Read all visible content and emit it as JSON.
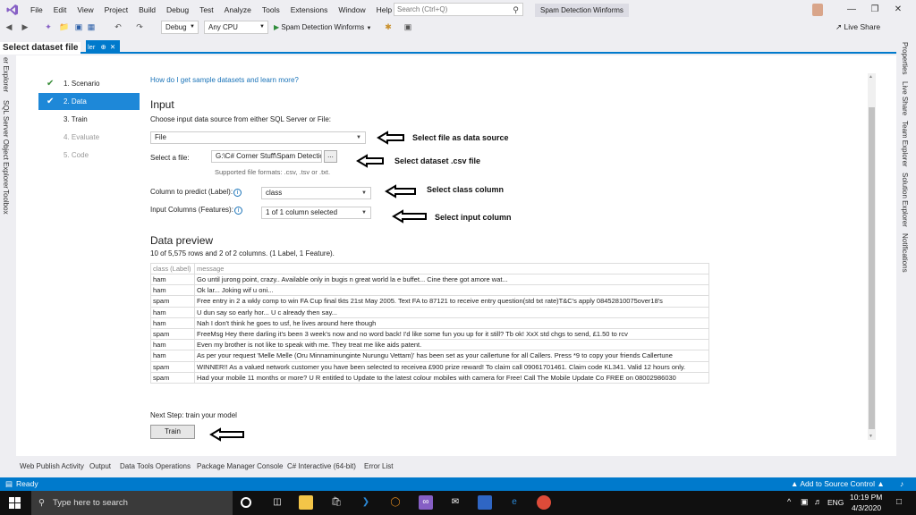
{
  "overlay_label": "Select dataset file",
  "menu": [
    "File",
    "Edit",
    "View",
    "Project",
    "Build",
    "Debug",
    "Test",
    "Analyze",
    "Tools",
    "Extensions",
    "Window",
    "Help"
  ],
  "search": {
    "placeholder": "Search (Ctrl+Q)"
  },
  "solution_title": "Spam Detection Winforms",
  "toolbar": {
    "config": "Debug",
    "platform": "Any CPU",
    "start_label": "Spam Detection Winforms",
    "live_share": "Live Share"
  },
  "doc_tab": {
    "label": "ler"
  },
  "left_panels": [
    "er Explorer",
    "SQL Server Object Explorer",
    "Toolbox"
  ],
  "right_panels": [
    "Properties",
    "Live Share",
    "Team Explorer",
    "Solution Explorer",
    "Notifications"
  ],
  "steps": [
    {
      "label": "1. Scenario",
      "state": "done"
    },
    {
      "label": "2. Data",
      "state": "active"
    },
    {
      "label": "3. Train",
      "state": "normal"
    },
    {
      "label": "4. Evaluate",
      "state": "disabled"
    },
    {
      "label": "5. Code",
      "state": "disabled"
    }
  ],
  "help_link": "How do I get sample datasets and learn more?",
  "input": {
    "heading": "Input",
    "description": "Choose input data source from either SQL Server or File:",
    "source_value": "File",
    "file_label": "Select a file:",
    "file_value": "G:\\C# Corner Stuff\\Spam Detectio",
    "browse_label": "...",
    "formats": "Supported file formats: .csv, .tsv or .txt.",
    "label_col_label": "Column to predict (Label):",
    "label_col_value": "class",
    "features_label": "Input Columns (Features):",
    "features_value": "1 of 1 column selected",
    "info_icon": "i"
  },
  "annotations": {
    "source": "Select file as data source",
    "dataset": "Select dataset .csv file",
    "class_col": "Select class column",
    "input_col": "Select input column"
  },
  "preview": {
    "heading": "Data preview",
    "subtitle": "10 of 5,575 rows and 2 of 2 columns. (1 Label, 1 Feature).",
    "columns": [
      "class (Label)",
      "message"
    ],
    "rows": [
      [
        "ham",
        "Go until jurong point, crazy.. Available only in bugis n great world la e buffet... Cine there got amore wat..."
      ],
      [
        "ham",
        "Ok lar... Joking wif u oni..."
      ],
      [
        "spam",
        "Free entry in 2 a wkly comp to win FA Cup final tkts 21st May 2005. Text FA to 87121 to receive entry question(std txt rate)T&C's apply 08452810075over18's"
      ],
      [
        "ham",
        "U dun say so early hor... U c already then say..."
      ],
      [
        "ham",
        "Nah I don't think he goes to usf, he lives around here though"
      ],
      [
        "spam",
        "FreeMsg Hey there darling it's been 3 week's now and no word back! I'd like some fun you up for it still? Tb ok! XxX std chgs to send, £1.50 to rcv"
      ],
      [
        "ham",
        "Even my brother is not like to speak with me. They treat me like aids patent."
      ],
      [
        "ham",
        "As per your request 'Melle Melle (Oru Minnaminunginte Nurungu Vettam)' has been set as your callertune for all Callers. Press *9 to copy your friends Callertune"
      ],
      [
        "spam",
        "WINNER!! As a valued network customer you have been selected to receivea £900 prize reward! To claim call 09061701461. Claim code KL341. Valid 12 hours only."
      ],
      [
        "spam",
        "Had your mobile 11 months or more? U R entitled to Update to the latest colour mobiles with camera for Free! Call The Mobile Update Co FREE on 08002986030"
      ]
    ]
  },
  "next_step": "Next Step: train your model",
  "train_button": "Train",
  "bottom_tabs": [
    "Web Publish Activity",
    "Output",
    "Data Tools Operations",
    "Package Manager Console",
    "C# Interactive (64-bit)",
    "Error List"
  ],
  "status": {
    "ready": "Ready",
    "source_control": "Add to Source Control"
  },
  "taskbar": {
    "search_placeholder": "Type here to search",
    "lang": "ENG",
    "time": "10:19 PM",
    "date": "4/3/2020"
  },
  "colors": {
    "accent": "#007acc",
    "step_active": "#1e88d8",
    "link": "#1a73b8"
  }
}
